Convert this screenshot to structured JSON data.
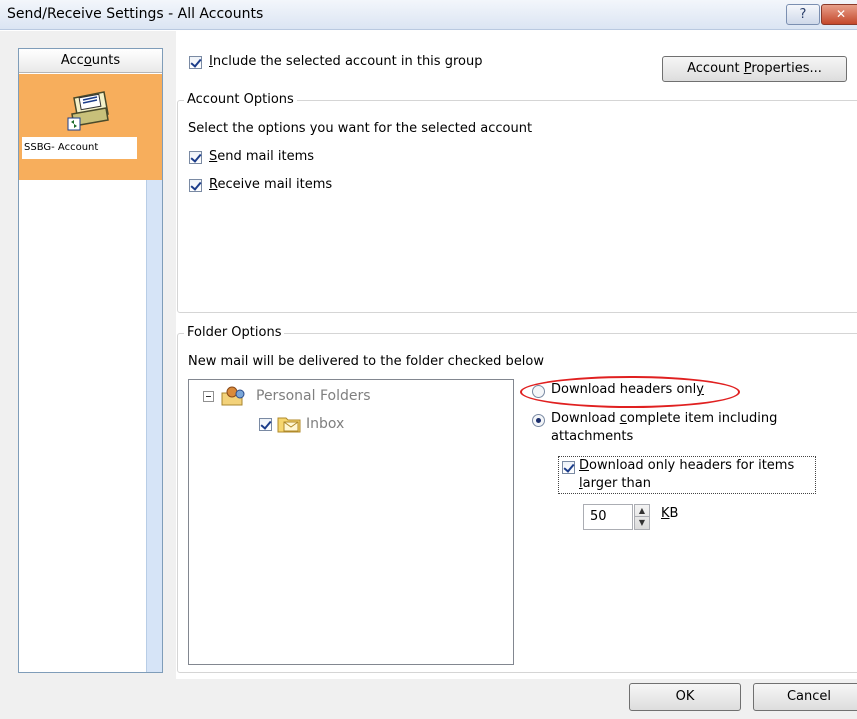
{
  "window": {
    "title": "Send/Receive Settings - All Accounts",
    "help_glyph": "?",
    "close_glyph": "✕"
  },
  "sidebar": {
    "header": "Accounts",
    "header_access_key": "o",
    "account": {
      "label": "SSBG- Account",
      "icon": "mail-account-icon"
    }
  },
  "include": {
    "label": "Include the selected account in this group",
    "checked": true
  },
  "account_properties_button": "Account Properties...",
  "account_options": {
    "legend": "Account Options",
    "instruction": "Select the options you want for the selected account",
    "send": {
      "label": "Send mail items",
      "checked": true
    },
    "receive": {
      "label": "Receive mail items",
      "checked": true
    }
  },
  "folder_options": {
    "legend": "Folder Options",
    "instruction": "New mail will be delivered to the folder checked below",
    "tree": {
      "root": {
        "label": "Personal Folders",
        "icon": "personal-folders-icon",
        "expanded": true
      },
      "child": {
        "label": "Inbox",
        "icon": "inbox-folder-icon",
        "checked": true
      }
    },
    "download_headers_only": {
      "label": "Download headers only",
      "selected": false
    },
    "download_complete": {
      "label_line1": "Download complete item including",
      "label_line2": "attachments",
      "selected": true
    },
    "download_large_headers": {
      "label_line1": "Download only headers for items",
      "label_line2": "larger than",
      "checked": true
    },
    "size": {
      "value": "50",
      "unit": "KB"
    }
  },
  "footer": {
    "ok": "OK",
    "cancel": "Cancel"
  },
  "colors": {
    "account_tile": "#f7ae5c",
    "annotation_ellipse": "#e02020"
  }
}
